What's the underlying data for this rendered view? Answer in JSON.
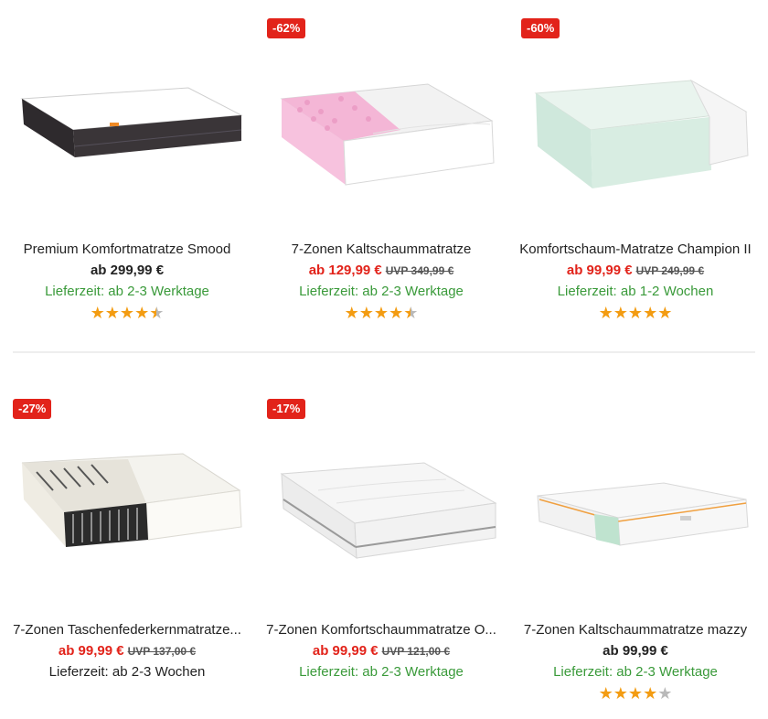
{
  "products": [
    {
      "badge": "",
      "title": "Premium Komfortmatratze Smood",
      "price": "ab 299,99 €",
      "uvp": "",
      "delivery": "Lieferzeit: ab 2-3 Werktage",
      "delivery_color": "green",
      "rating": 4.5,
      "image": "black-boxspring-mattress"
    },
    {
      "badge": "-62%",
      "title": "7-Zonen Kaltschaummatratze",
      "price": "ab 129,99 €",
      "uvp": "UVP 349,99 €",
      "delivery": "Lieferzeit: ab 2-3 Werktage",
      "delivery_color": "green",
      "rating": 4.5,
      "image": "pink-foam-cutaway-mattress"
    },
    {
      "badge": "-60%",
      "title": "Komfortschaum-Matratze Champion II",
      "price": "ab 99,99 €",
      "uvp": "UVP 249,99 €",
      "delivery": "Lieferzeit: ab 1-2 Wochen",
      "delivery_color": "green",
      "rating": 5,
      "image": "mint-foam-cutaway-mattress"
    },
    {
      "badge": "-27%",
      "title": "7-Zonen Taschenfederkernmatratze...",
      "price": "ab 99,99 €",
      "uvp": "UVP 137,00 €",
      "delivery": "Lieferzeit: ab 2-3 Wochen",
      "delivery_color": "dark",
      "rating": 0,
      "image": "pocket-spring-cutaway-mattress"
    },
    {
      "badge": "-17%",
      "title": "7-Zonen Komfortschaummatratze O...",
      "price": "ab 99,99 €",
      "uvp": "UVP 121,00 €",
      "delivery": "Lieferzeit: ab 2-3 Werktage",
      "delivery_color": "green",
      "rating": 0,
      "image": "white-quilted-mattress"
    },
    {
      "badge": "",
      "title": "7-Zonen Kaltschaummatratze mazzy",
      "price": "ab 99,99 €",
      "uvp": "",
      "delivery": "Lieferzeit: ab 2-3 Werktage",
      "delivery_color": "green",
      "rating": 4,
      "image": "white-mattress-green-corner"
    }
  ],
  "colors": {
    "sale": "#e2231a",
    "delivery_green": "#3a9a3a",
    "star": "#f39c12",
    "star_empty": "#b9b9b9"
  }
}
